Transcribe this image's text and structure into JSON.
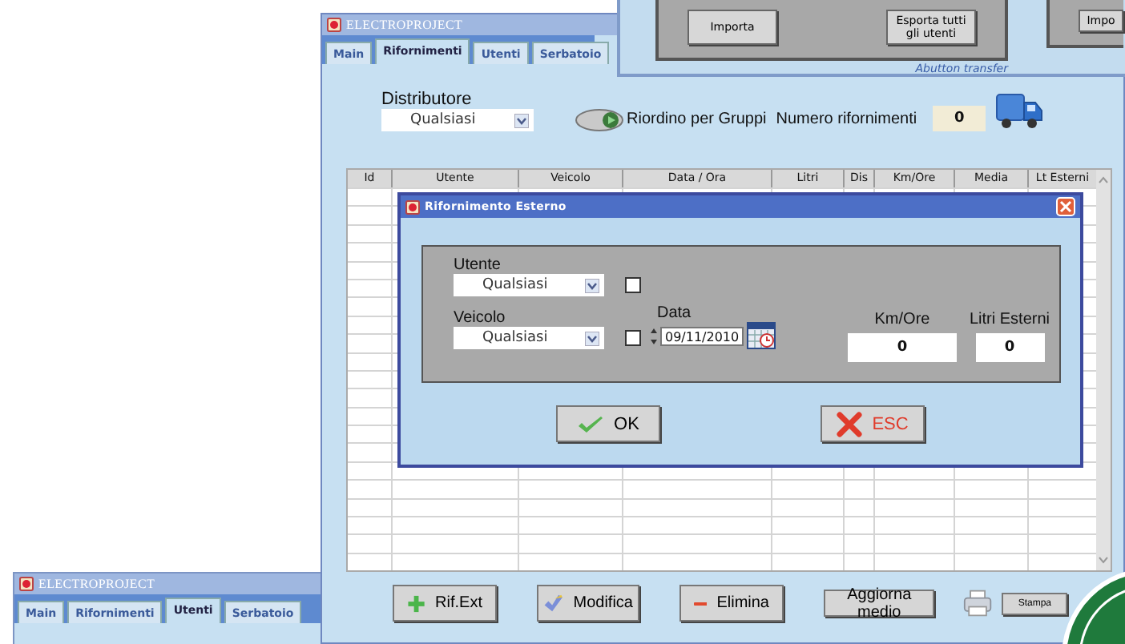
{
  "top_window": {
    "panels": [
      {
        "buttons": [
          "Importa",
          "Esporta tutti gli utenti"
        ],
        "caption": "Abutton transfer"
      },
      {
        "buttons": [
          "Impo"
        ]
      }
    ]
  },
  "back_window": {
    "title": "ELECTROPROJECT",
    "tabs": [
      {
        "label": "Main",
        "selected": false
      },
      {
        "label": "Rifornimenti",
        "selected": false
      },
      {
        "label": "Utenti",
        "selected": true
      },
      {
        "label": "Serbatoio",
        "selected": false
      }
    ]
  },
  "main_window": {
    "title": "ELECTROPROJECT",
    "tabs": [
      {
        "label": "Main",
        "selected": false
      },
      {
        "label": "Rifornimenti",
        "selected": true
      },
      {
        "label": "Utenti",
        "selected": false
      },
      {
        "label": "Serbatoio",
        "selected": false
      }
    ],
    "distributor": {
      "label": "Distributore",
      "value": "Qualsiasi"
    },
    "regroup_button": "Riordino per Gruppi",
    "count": {
      "label": "Numero rifornimenti",
      "value": "0"
    },
    "table": {
      "columns": [
        "Id",
        "Utente",
        "Veicolo",
        "Data / Ora",
        "Litri",
        "Dis",
        "Km/Ore",
        "Media",
        "Lt Esterni"
      ]
    },
    "buttons": [
      {
        "label": "Rif.Ext",
        "kind": "add"
      },
      {
        "label": "Modifica",
        "kind": "edit"
      },
      {
        "label": "Elimina",
        "kind": "delete"
      },
      {
        "label": "Aggiorna medio",
        "kind": "plain"
      },
      {
        "label": "Stampa",
        "kind": "print"
      }
    ]
  },
  "dialog": {
    "title": "Rifornimento Esterno",
    "user": {
      "label": "Utente",
      "value": "Qualsiasi",
      "checked": false
    },
    "vehicle": {
      "label": "Veicolo",
      "value": "Qualsiasi",
      "checked": false
    },
    "date": {
      "label": "Data",
      "value": "09/11/2010"
    },
    "km": {
      "label": "Km/Ore",
      "value": "0"
    },
    "liters": {
      "label": "Litri Esterni",
      "value": "0"
    },
    "buttons": [
      {
        "label": "OK",
        "kind": "ok"
      },
      {
        "label": "ESC",
        "kind": "cancel"
      }
    ]
  }
}
